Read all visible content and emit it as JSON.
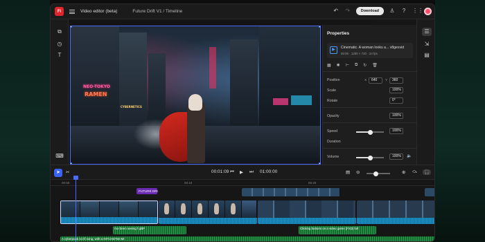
{
  "app": {
    "logo_text": "Fi",
    "title": "Video editor (beta)",
    "breadcrumb": "Future Drift V1 / Timeline",
    "download_label": "Download",
    "accent": "#3b63f0",
    "brand": "#e0252d"
  },
  "topbar_icons": [
    "undo-icon",
    "redo-icon",
    "user-icon",
    "help-icon",
    "apps-grid-icon"
  ],
  "left_tools": [
    "media-icon",
    "history-icon",
    "text-icon",
    "keyboard-icon"
  ],
  "preview": {
    "signs": [
      "NEO-TOKYO",
      "RAMEN",
      "CYBERNETICS"
    ]
  },
  "properties": {
    "title": "Properties",
    "clip_name": "Cinematic. A woman looks a... v8gexvid",
    "clip_meta": "00:06 · 1280 × 720 · 24 fps",
    "position_label": "Position",
    "position_x_label": "X",
    "position_x": "640",
    "position_y_label": "Y",
    "position_y": "360",
    "scale_label": "Scale",
    "scale_value": "100%",
    "rotate_label": "Rotate",
    "rotate_value": "0°",
    "opacity_label": "Opacity",
    "opacity_value": "100%",
    "speed_label": "Speed",
    "speed_value": "100%",
    "speed_level": 0.5,
    "duration_label": "Duration",
    "duration_value": "",
    "volume_label": "Volume",
    "volume_value": "100%",
    "volume_level": 0.5
  },
  "right_rail": [
    "properties-sliders-icon",
    "adjust-icon",
    "captions-icon"
  ],
  "transport": {
    "current_time": "00:01:09",
    "total_time": "01:00:00"
  },
  "timeline": {
    "ticks": [
      "00:00",
      "00:10",
      "00:20"
    ],
    "title_clip": "FUTURE DRI",
    "audio1": "I've been seeing f glitP",
    "audio2": "Clicking buttons on a video game [FXD] full",
    "audio3": "A cyberpunk sci-fi song, with a INTCHDT50 MI"
  }
}
